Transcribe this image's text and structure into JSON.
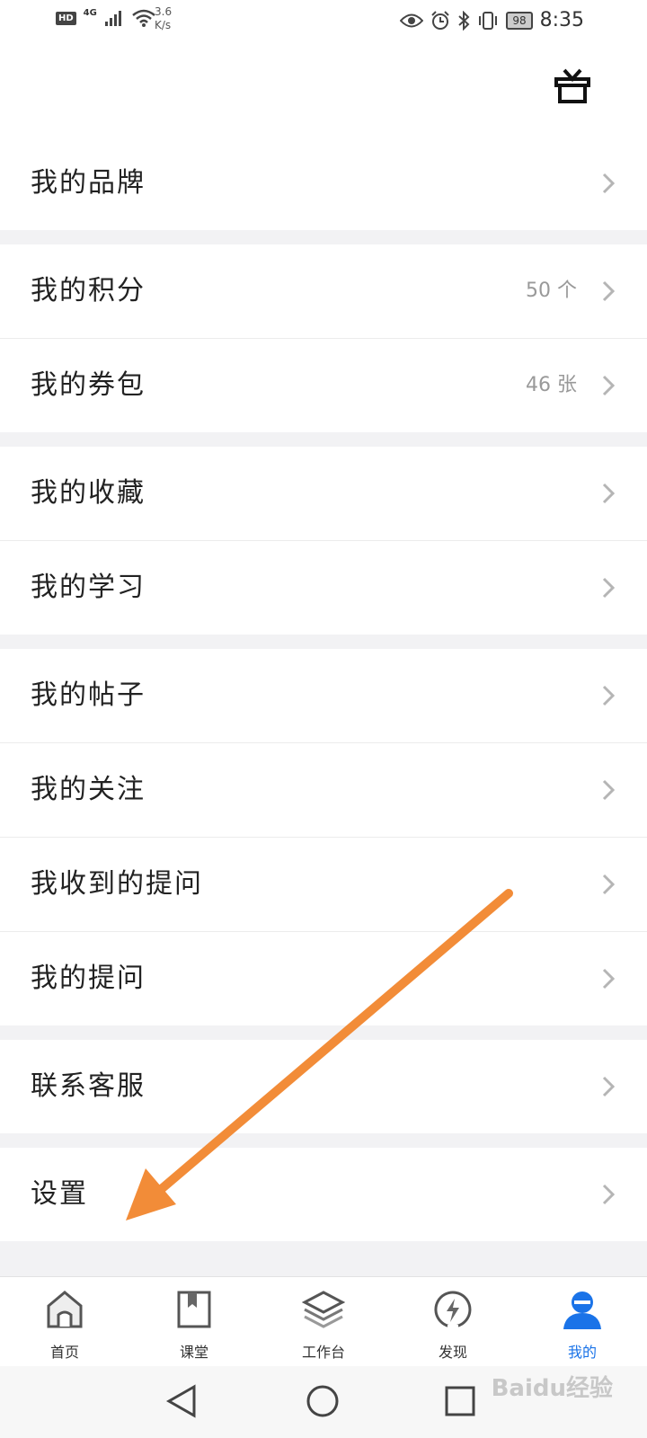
{
  "status": {
    "network": "4G",
    "hd": "HD",
    "speed_value": "3.6",
    "speed_unit": "K/s",
    "battery": "98",
    "time": "8:35"
  },
  "groups": [
    [
      {
        "label": "我的品牌",
        "value": ""
      }
    ],
    [
      {
        "label": "我的积分",
        "value": "50 个"
      },
      {
        "label": "我的券包",
        "value": "46 张"
      }
    ],
    [
      {
        "label": "我的收藏",
        "value": ""
      },
      {
        "label": "我的学习",
        "value": ""
      }
    ],
    [
      {
        "label": "我的帖子",
        "value": ""
      },
      {
        "label": "我的关注",
        "value": ""
      },
      {
        "label": "我收到的提问",
        "value": ""
      },
      {
        "label": "我的提问",
        "value": ""
      }
    ],
    [
      {
        "label": "联系客服",
        "value": ""
      }
    ],
    [
      {
        "label": "设置",
        "value": ""
      }
    ]
  ],
  "tabs": [
    {
      "label": "首页",
      "icon": "home-icon"
    },
    {
      "label": "课堂",
      "icon": "book-icon"
    },
    {
      "label": "工作台",
      "icon": "layers-icon"
    },
    {
      "label": "发现",
      "icon": "discover-icon"
    },
    {
      "label": "我的",
      "icon": "profile-icon",
      "active": true
    }
  ],
  "watermark": "Baidu经验",
  "colors": {
    "accent": "#1a73e8",
    "arrow": "#f28c38",
    "chevron": "#b5b5b5"
  }
}
